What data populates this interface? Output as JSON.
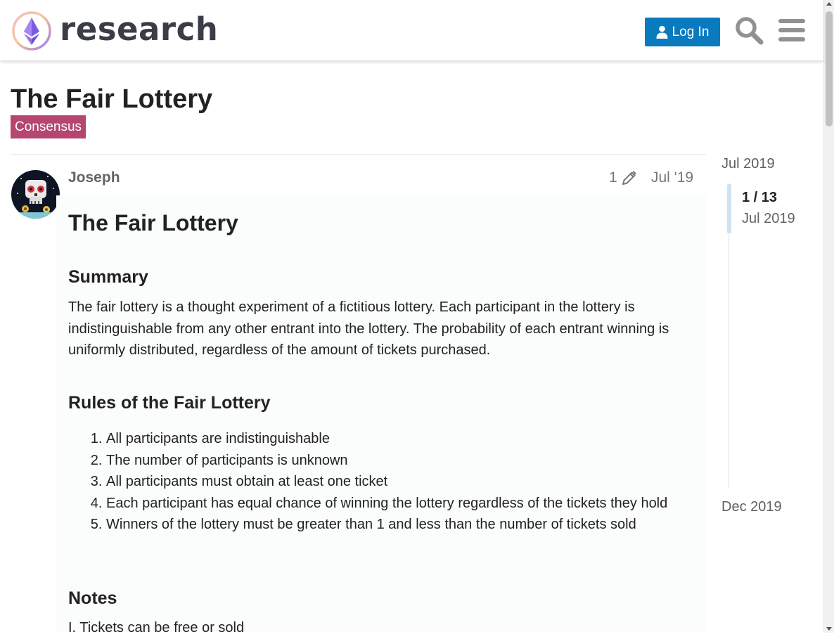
{
  "header": {
    "logo_text": "research",
    "login_label": "Log In"
  },
  "topic": {
    "title": "The Fair Lottery",
    "category": "Consensus"
  },
  "post": {
    "author": "Joseph",
    "edit_count": "1",
    "date": "Jul '19",
    "heading": "The Fair Lottery",
    "summary_heading": "Summary",
    "summary_text": "The fair lottery is a thought experiment of a fictitious lottery. Each participant in the lottery is indistinguishable from any other entrant into the lottery. The probability of each entrant winning is uniformly distributed, regardless of the amount of tickets purchased.",
    "rules_heading": "Rules of the Fair Lottery",
    "rules": [
      "All participants are indistinguishable",
      "The number of participants is unknown",
      "All participants must obtain at least one ticket",
      "Each participant has equal chance of winning the lottery regardless of the tickets they hold",
      "Winners of the lottery must be greater than 1 and less than the number of tickets sold"
    ],
    "notes_heading": "Notes",
    "notes_first": "I. Tickets can be free or sold"
  },
  "timeline": {
    "start": "Jul 2019",
    "progress": "1 / 13",
    "current_date": "Jul 2019",
    "end": "Dec 2019"
  },
  "colors": {
    "accent": "#0a7abf",
    "category": "#b5466f"
  },
  "icons": {
    "logo": "ethereum-research-logo",
    "login": "user-icon",
    "search": "search-icon",
    "menu": "hamburger-menu-icon",
    "edit": "pencil-icon"
  }
}
